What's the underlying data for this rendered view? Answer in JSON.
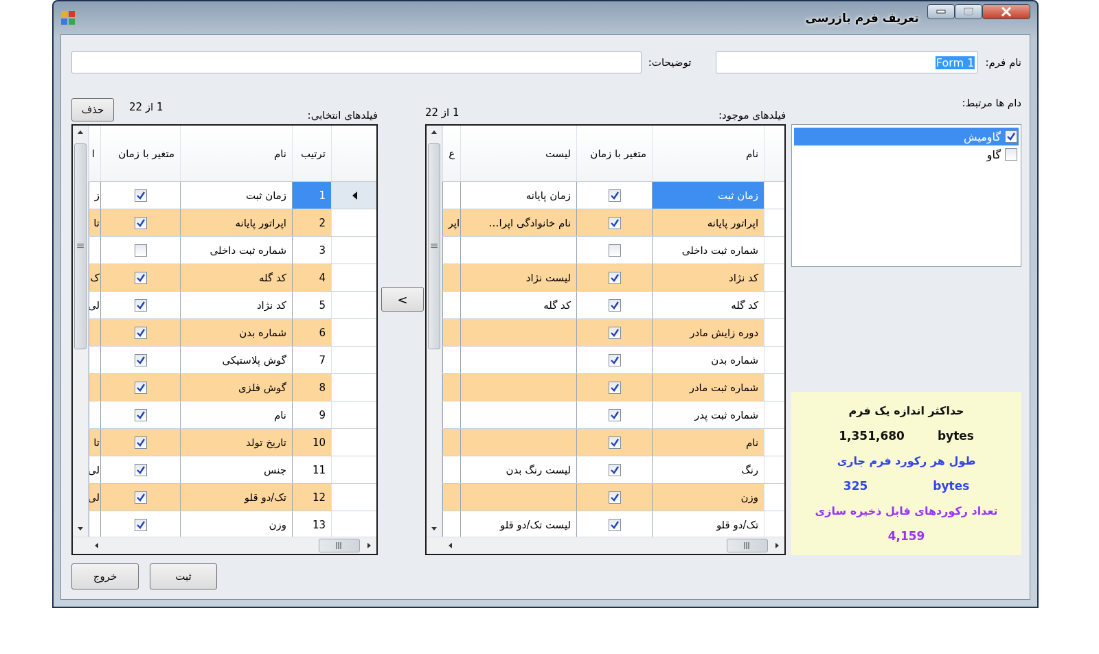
{
  "window": {
    "title": "تعریف فرم بازرسی"
  },
  "form_name": {
    "label": "نام فرم:",
    "value": "Form 1"
  },
  "description": {
    "label": "توضیحات:"
  },
  "related_animals": {
    "label": "دام ها مرتبط:",
    "items": [
      {
        "label": "گاومیش",
        "checked": true,
        "selected": true
      },
      {
        "label": "گاو",
        "checked": false,
        "selected": false
      }
    ]
  },
  "available_fields": {
    "label": "فیلدهای موجود:",
    "counter": "1 از 22",
    "columns": [
      "نام",
      "متغیر با زمان",
      "لیست",
      "ع"
    ],
    "rows": [
      {
        "name": "زمان ثبت",
        "time_variant": true,
        "list": "زمان پایانه",
        "selected": true
      },
      {
        "name": "اپراتور پایانه",
        "time_variant": true,
        "list": "نام خانوادگی اپرا…",
        "column_4": "اپر",
        "selected": false
      },
      {
        "name": "شماره ثبت داخلی",
        "time_variant": false,
        "selected": false
      },
      {
        "name": "کد نژاد",
        "time_variant": true,
        "list": "لیست نژاد",
        "selected": false
      },
      {
        "name": "کد گله",
        "time_variant": true,
        "list": "کد گله",
        "selected": false
      },
      {
        "name": "دوره زایش مادر",
        "time_variant": true,
        "selected": false
      },
      {
        "name": "شماره بدن",
        "time_variant": true,
        "selected": false
      },
      {
        "name": "شماره ثبت مادر",
        "time_variant": true,
        "selected": false
      },
      {
        "name": "شماره ثبت پدر",
        "time_variant": true,
        "selected": false
      },
      {
        "name": "نام",
        "time_variant": true,
        "selected": false
      },
      {
        "name": "رنگ",
        "time_variant": true,
        "list": "لیست رنگ بدن",
        "selected": false
      },
      {
        "name": "وزن",
        "time_variant": true,
        "selected": false
      },
      {
        "name": "تک/دو قلو",
        "time_variant": true,
        "list": "لیست تک/دو قلو",
        "selected": false
      }
    ]
  },
  "move_button": {
    "label": "<"
  },
  "selected_fields": {
    "label": "فیلدهای انتخابی:",
    "counter": "1 از 22",
    "delete_button": "حذف",
    "columns": [
      "ترتیب",
      "نام",
      "متغیر با زمان",
      "ا"
    ],
    "rows": [
      {
        "order": "1",
        "name": "زمان ثبت",
        "time_variant": true,
        "column_4": "ز",
        "selected": true,
        "current": true
      },
      {
        "order": "2",
        "name": "اپراتور پایانه",
        "time_variant": true,
        "column_4": "تا",
        "selected": false,
        "current": false
      },
      {
        "order": "3",
        "name": "شماره ثبت داخلی",
        "time_variant": false,
        "selected": false,
        "current": false
      },
      {
        "order": "4",
        "name": "کد گله",
        "time_variant": true,
        "column_4": "ک",
        "selected": false,
        "current": false
      },
      {
        "order": "5",
        "name": "کد نژاد",
        "time_variant": true,
        "column_4": "لی",
        "selected": false,
        "current": false
      },
      {
        "order": "6",
        "name": "شماره بدن",
        "time_variant": true,
        "selected": false,
        "current": false
      },
      {
        "order": "7",
        "name": "گوش پلاستیکی",
        "time_variant": true,
        "selected": false,
        "current": false
      },
      {
        "order": "8",
        "name": "گوش فلزی",
        "time_variant": true,
        "selected": false,
        "current": false
      },
      {
        "order": "9",
        "name": "نام",
        "time_variant": true,
        "selected": false,
        "current": false
      },
      {
        "order": "10",
        "name": "تاریخ تولد",
        "time_variant": true,
        "column_4": "تا",
        "selected": false,
        "current": false
      },
      {
        "order": "11",
        "name": "جنس",
        "time_variant": true,
        "column_4": "لی",
        "selected": false,
        "current": false
      },
      {
        "order": "12",
        "name": "تک/دو قلو",
        "time_variant": true,
        "column_4": "لی",
        "selected": false,
        "current": false
      },
      {
        "order": "13",
        "name": "وزن",
        "time_variant": true,
        "selected": false,
        "current": false
      }
    ]
  },
  "info": [
    {
      "kind": "text",
      "text": "حداکثر اندازه یک فرم",
      "color": "#111111"
    },
    {
      "kind": "amount",
      "value": "1,351,680",
      "unit": "bytes",
      "color": "#111111"
    },
    {
      "kind": "text",
      "text": "طول هر رکورد فرم جاری",
      "color": "#3344ee"
    },
    {
      "kind": "amount",
      "value": "325",
      "unit": "bytes",
      "color": "#3344ee"
    },
    {
      "kind": "text",
      "text": "تعداد رکوردهای قابل ذخیره سازی",
      "color": "#9933ff"
    },
    {
      "kind": "amount",
      "value": "4,159",
      "color": "#9933ff"
    }
  ],
  "buttons": [
    {
      "label": "ثبت"
    },
    {
      "label": "خروج"
    }
  ]
}
